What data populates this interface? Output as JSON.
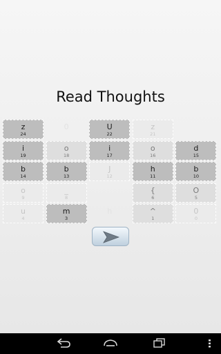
{
  "title": "Read Thoughts",
  "grid": [
    {
      "ch": "z",
      "num": "24",
      "tone": "dark"
    },
    {
      "ch": "0",
      "num": "",
      "tone": "empty"
    },
    {
      "ch": "U",
      "num": "22",
      "tone": "dark"
    },
    {
      "ch": "z",
      "num": "21",
      "tone": "faint"
    },
    {
      "ch": "",
      "num": "",
      "tone": "empty"
    },
    {
      "ch": "i",
      "num": "19",
      "tone": "dark"
    },
    {
      "ch": "o",
      "num": "18",
      "tone": "light"
    },
    {
      "ch": "i",
      "num": "17",
      "tone": "dark"
    },
    {
      "ch": "o",
      "num": "16",
      "tone": "light"
    },
    {
      "ch": "d",
      "num": "15",
      "tone": "dark"
    },
    {
      "ch": "b",
      "num": "14",
      "tone": "dark"
    },
    {
      "ch": "b",
      "num": "13",
      "tone": "dark"
    },
    {
      "ch": "J",
      "num": "12",
      "tone": "faint"
    },
    {
      "ch": "h",
      "num": "11",
      "tone": "dark"
    },
    {
      "ch": "b",
      "num": "10",
      "tone": "dark"
    },
    {
      "ch": "o",
      "num": "9",
      "tone": "faint"
    },
    {
      "ch": "_",
      "num": "8",
      "tone": "faint"
    },
    {
      "ch": "",
      "num": "",
      "tone": "empty"
    },
    {
      "ch": "{",
      "num": "6",
      "tone": "light"
    },
    {
      "ch": "O",
      "num": "5",
      "tone": "light"
    },
    {
      "ch": "u",
      "num": "4",
      "tone": "faint"
    },
    {
      "ch": "m",
      "num": "3",
      "tone": "dark"
    },
    {
      "ch": "h",
      "num": "",
      "tone": "empty"
    },
    {
      "ch": "^",
      "num": "1",
      "tone": "light"
    },
    {
      "ch": "0",
      "num": "0",
      "tone": "faint"
    }
  ],
  "next_button": {
    "icon": "arrow-right-icon"
  },
  "navbar": {
    "icons": [
      "back-icon",
      "home-icon",
      "recents-icon",
      "menu-icon"
    ]
  }
}
